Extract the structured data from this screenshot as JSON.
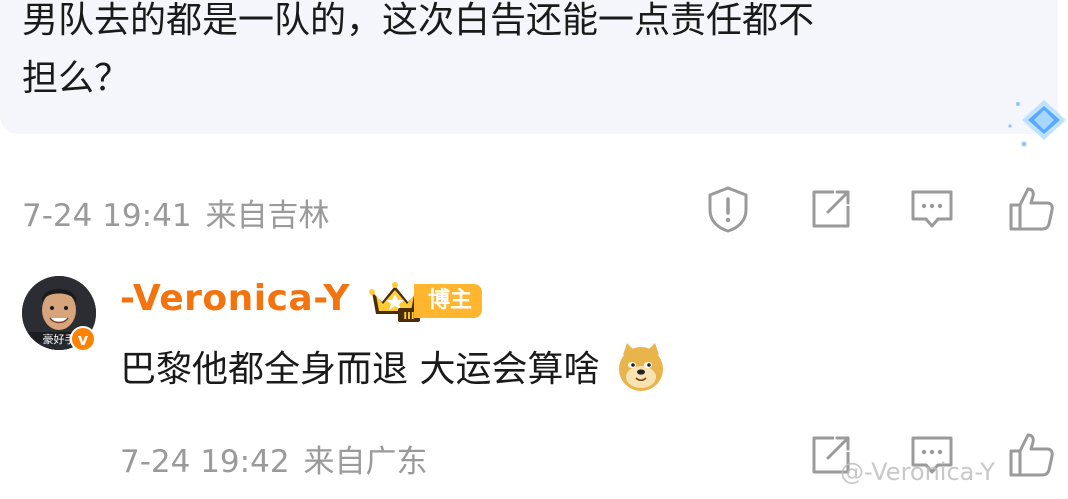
{
  "comment": {
    "text_line1": "男队去的都是一队的，这次白告还能一点责任都不",
    "text_line2": "担么？",
    "date": "7-24 19:41",
    "location": "来自吉林"
  },
  "reply": {
    "username": "-Veronica-Y",
    "avatar_caption": "豪好手",
    "verified_mark": "v",
    "level": "III",
    "role_tag": "博主",
    "text": "巴黎他都全身而退 大运会算啥",
    "emoji": "doge-emoji",
    "date": "7-24 19:42",
    "location": "来自广东"
  },
  "watermark": "@-Veronica-Y",
  "icons": {
    "report": "shield-alert-icon",
    "share": "share-edit-icon",
    "comment": "comment-icon",
    "like": "thumbs-up-icon"
  },
  "colors": {
    "username": "#f3730f",
    "tag": "#ffb52e",
    "meta": "#9a9a9a",
    "bubble": "#f4f6fb"
  }
}
